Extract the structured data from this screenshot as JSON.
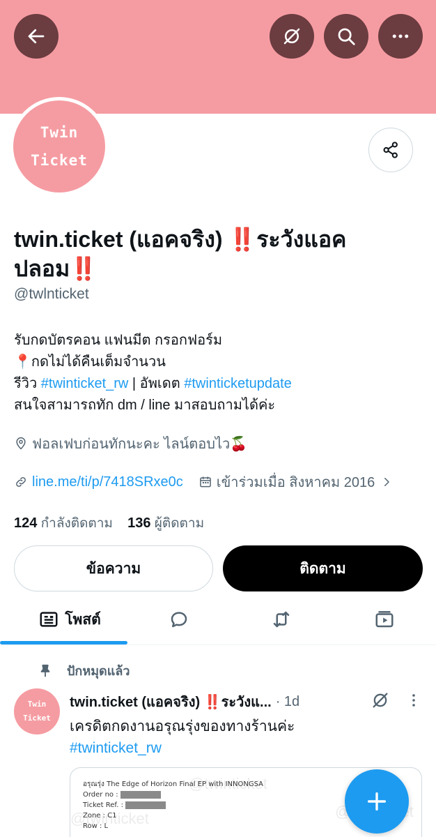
{
  "header": {
    "back_icon": "arrow-left-icon",
    "translate_icon": "grok-icon",
    "search_icon": "search-icon",
    "more_icon": "more-horizontal-icon",
    "banner_color": "#f59ca2"
  },
  "profile": {
    "avatar_line1": "Twin",
    "avatar_line2": "Ticket",
    "display_name": "twin.ticket (แอคจริง) ‼️ระวังแอคปลอม‼️",
    "handle": "@twlnticket",
    "bio": {
      "line1": "รับกดบัตรคอน แฟนมีต กรอกฟอร์ม",
      "line2": "📍กดไม่ได้คืนเต็มจำนวน",
      "line3_prefix": "รีวิว ",
      "line3_tag1": "#twinticket_rw",
      "line3_mid": " | อัพเดต ",
      "line3_tag2": "#twinticketupdate",
      "line4": "สนใจสามารถทัก dm / line มาสอบถามได้ค่ะ"
    },
    "location": "ฟอลเฟบก่อนทักนะคะ ไลน์ตอบไว🍒",
    "website": "line.me/ti/p/7418SRxe0c",
    "joined": "เข้าร่วมเมื่อ สิงหาคม 2016",
    "following_count": "124",
    "following_label": "กำลังติดตาม",
    "followers_count": "136",
    "followers_label": "ผู้ติดตาม",
    "message_button": "ข้อความ",
    "follow_button": "ติดตาม"
  },
  "tabs": {
    "posts_label": "โพสต์"
  },
  "pinned_post": {
    "pinned_label": "ปักหมุดแล้ว",
    "author": "twin.ticket (แอคจริง) ‼️ระวังแ...",
    "time": "· 1d",
    "text_line1": "เครดิตกดงานอรุณรุ่งของทางร้านค่ะ",
    "hashtag": "#twinticket_rw",
    "ticket": {
      "title": "อรุณรุ่ง The Edge of Horizon Final EP with INNONGSA",
      "order_no": "Order no :",
      "ticket_ref": "Ticket Ref. :",
      "zone": "Zone : C1",
      "row": "Row : L"
    },
    "watermark": "@twinticket"
  },
  "accent_color": "#1d9bf0"
}
